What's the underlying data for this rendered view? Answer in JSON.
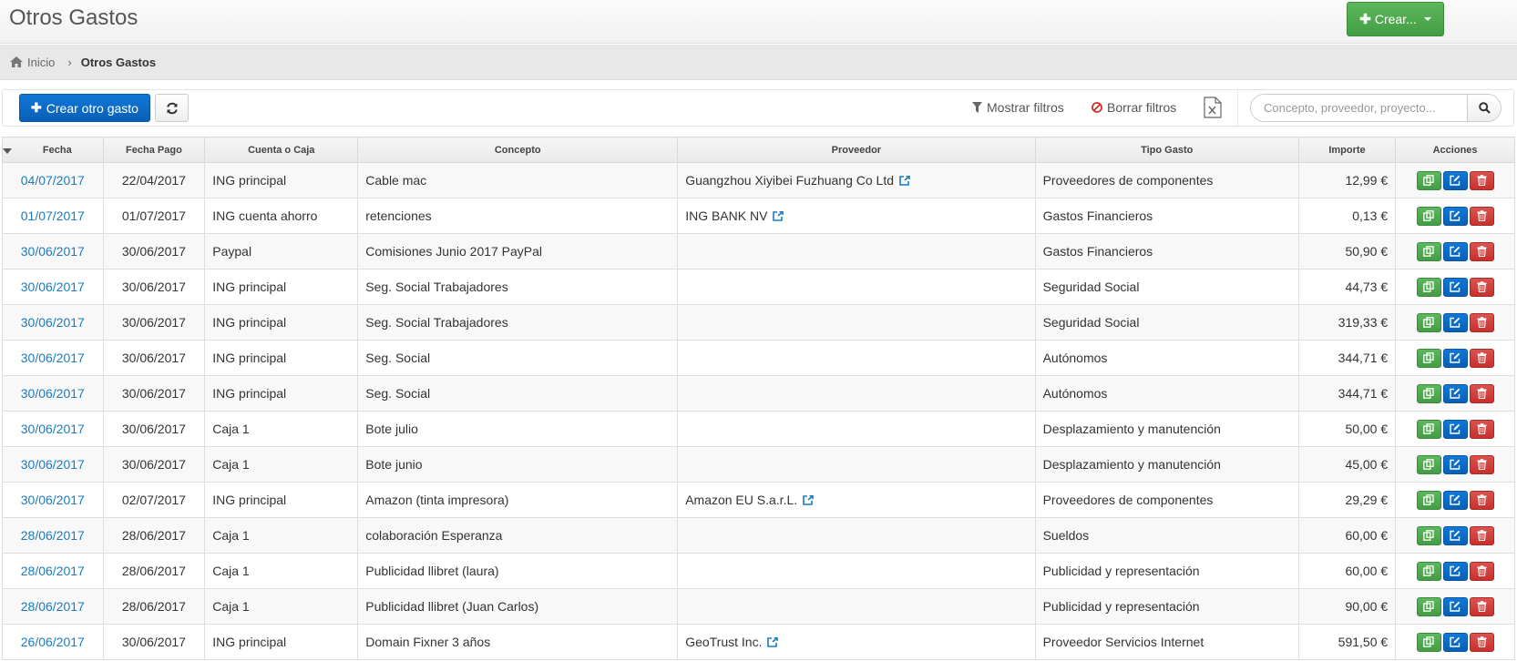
{
  "header": {
    "title": "Otros Gastos",
    "create_button": "Crear..."
  },
  "breadcrumb": {
    "home": "Inicio",
    "current": "Otros Gastos"
  },
  "toolbar": {
    "create_label": "Crear otro gasto",
    "show_filters": "Mostrar filtros",
    "clear_filters": "Borrar filtros",
    "search_placeholder": "Concepto, proveedor, proyecto..."
  },
  "table": {
    "headers": [
      "Fecha",
      "Fecha Pago",
      "Cuenta o Caja",
      "Concepto",
      "Proveedor",
      "Tipo Gasto",
      "Importe",
      "Acciones"
    ],
    "rows": [
      {
        "fecha": "04/07/2017",
        "fecha_pago": "22/04/2017",
        "cuenta": "ING principal",
        "concepto": "Cable mac",
        "proveedor": "Guangzhou Xiyibei Fuzhuang Co Ltd",
        "tipo": "Proveedores de componentes",
        "importe": "12,99 €"
      },
      {
        "fecha": "01/07/2017",
        "fecha_pago": "01/07/2017",
        "cuenta": "ING cuenta ahorro",
        "concepto": "retenciones",
        "proveedor": "ING BANK NV",
        "tipo": "Gastos Financieros",
        "importe": "0,13 €"
      },
      {
        "fecha": "30/06/2017",
        "fecha_pago": "30/06/2017",
        "cuenta": "Paypal",
        "concepto": "Comisiones Junio 2017 PayPal",
        "proveedor": "",
        "tipo": "Gastos Financieros",
        "importe": "50,90 €"
      },
      {
        "fecha": "30/06/2017",
        "fecha_pago": "30/06/2017",
        "cuenta": "ING principal",
        "concepto": "Seg. Social Trabajadores",
        "proveedor": "",
        "tipo": "Seguridad Social",
        "importe": "44,73 €"
      },
      {
        "fecha": "30/06/2017",
        "fecha_pago": "30/06/2017",
        "cuenta": "ING principal",
        "concepto": "Seg. Social Trabajadores",
        "proveedor": "",
        "tipo": "Seguridad Social",
        "importe": "319,33 €"
      },
      {
        "fecha": "30/06/2017",
        "fecha_pago": "30/06/2017",
        "cuenta": "ING principal",
        "concepto": "Seg. Social",
        "proveedor": "",
        "tipo": "Autónomos",
        "importe": "344,71 €"
      },
      {
        "fecha": "30/06/2017",
        "fecha_pago": "30/06/2017",
        "cuenta": "ING principal",
        "concepto": "Seg. Social",
        "proveedor": "",
        "tipo": "Autónomos",
        "importe": "344,71 €"
      },
      {
        "fecha": "30/06/2017",
        "fecha_pago": "30/06/2017",
        "cuenta": "Caja 1",
        "concepto": "Bote julio",
        "proveedor": "",
        "tipo": "Desplazamiento y manutención",
        "importe": "50,00 €"
      },
      {
        "fecha": "30/06/2017",
        "fecha_pago": "30/06/2017",
        "cuenta": "Caja 1",
        "concepto": "Bote junio",
        "proveedor": "",
        "tipo": "Desplazamiento y manutención",
        "importe": "45,00 €"
      },
      {
        "fecha": "30/06/2017",
        "fecha_pago": "02/07/2017",
        "cuenta": "ING principal",
        "concepto": "Amazon (tinta impresora)",
        "proveedor": "Amazon EU S.a.r.L.",
        "tipo": "Proveedores de componentes",
        "importe": "29,29 €"
      },
      {
        "fecha": "28/06/2017",
        "fecha_pago": "28/06/2017",
        "cuenta": "Caja 1",
        "concepto": "colaboración Esperanza",
        "proveedor": "",
        "tipo": "Sueldos",
        "importe": "60,00 €"
      },
      {
        "fecha": "28/06/2017",
        "fecha_pago": "28/06/2017",
        "cuenta": "Caja 1",
        "concepto": "Publicidad llibret (laura)",
        "proveedor": "",
        "tipo": "Publicidad y representación",
        "importe": "60,00 €"
      },
      {
        "fecha": "28/06/2017",
        "fecha_pago": "28/06/2017",
        "cuenta": "Caja 1",
        "concepto": "Publicidad llibret (Juan Carlos)",
        "proveedor": "",
        "tipo": "Publicidad y representación",
        "importe": "90,00 €"
      },
      {
        "fecha": "26/06/2017",
        "fecha_pago": "30/06/2017",
        "cuenta": "ING principal",
        "concepto": "Domain Fixner 3 años",
        "proveedor": "GeoTrust Inc.",
        "tipo": "Proveedor Servicios Internet",
        "importe": "591,50 €"
      }
    ]
  },
  "icons": {
    "home": "home-icon",
    "chevron": "chevron-right-icon",
    "plus": "plus-icon",
    "refresh": "refresh-icon",
    "filter": "filter-icon",
    "ban": "ban-icon",
    "excel": "excel-icon",
    "search": "search-icon",
    "external": "external-link-icon",
    "copy": "copy-icon",
    "edit": "edit-icon",
    "delete": "trash-icon"
  },
  "colors": {
    "link": "#1a7bc0",
    "success": "#5cb85c",
    "primary": "#0f6fc6",
    "danger": "#d9534f"
  }
}
